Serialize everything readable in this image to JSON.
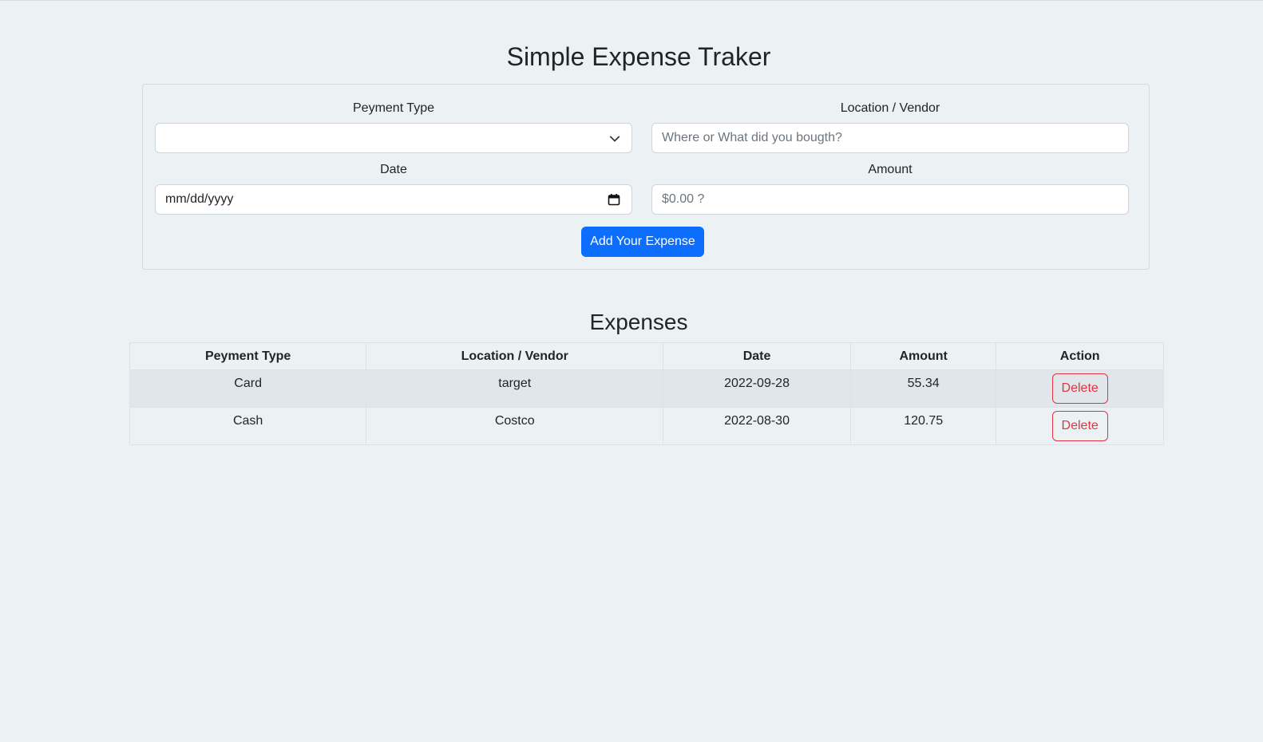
{
  "app": {
    "title": "Simple Expense Traker"
  },
  "form": {
    "payment_type": {
      "label": "Peyment Type",
      "value": ""
    },
    "location": {
      "label": "Location / Vendor",
      "placeholder": "Where or What did you bougth?"
    },
    "date": {
      "label": "Date",
      "placeholder": "mm/dd/yyyy"
    },
    "amount": {
      "label": "Amount",
      "placeholder": "$0.00 ?"
    },
    "submit_label": "Add Your Expense"
  },
  "expenses": {
    "title": "Expenses",
    "columns": [
      "Peyment Type",
      "Location / Vendor",
      "Date",
      "Amount",
      "Action"
    ],
    "rows": [
      {
        "payment_type": "Card",
        "location": "target",
        "date": "2022-09-28",
        "amount": "55.34",
        "action": "Delete"
      },
      {
        "payment_type": "Cash",
        "location": "Costco",
        "date": "2022-08-30",
        "amount": "120.75",
        "action": "Delete"
      }
    ]
  },
  "colors": {
    "background": "#ecf1f4",
    "primary": "#0d6efd",
    "danger": "#dc3545",
    "stripe": "#e1e6ea"
  },
  "icons": {
    "select_caret": "chevron-down-icon",
    "date_picker": "calendar-icon"
  }
}
